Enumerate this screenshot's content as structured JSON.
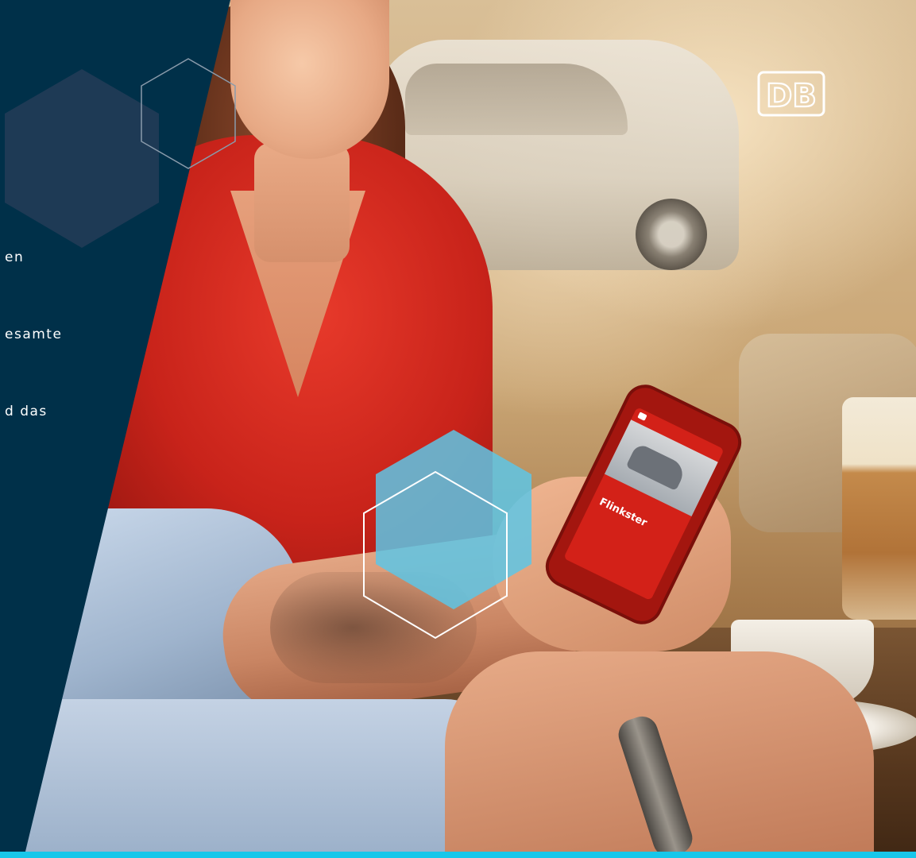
{
  "logo": {
    "text": "DB",
    "color": "#ffffff"
  },
  "phone_app": {
    "title": "Flinkster"
  },
  "panel": {
    "background": "#003049",
    "text_lines": [
      "en",
      "esamte",
      "d das"
    ]
  },
  "colors": {
    "accent_cyan": "#17c7ea",
    "hexagon_fill": "#1e3a55",
    "hexagon_outline": "#ffffff",
    "hexagon_cyan": "#5ec6e5"
  },
  "icons": [
    "hexagon-icon",
    "db-logo-icon"
  ]
}
